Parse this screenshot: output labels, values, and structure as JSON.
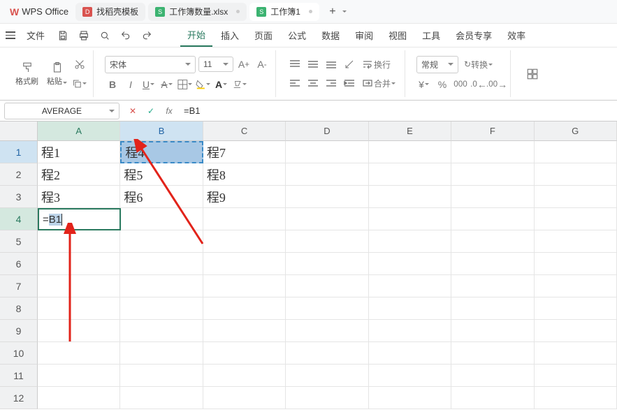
{
  "app": {
    "name": "WPS Office"
  },
  "tabs": [
    {
      "label": "找稻壳模板",
      "iconColor": "#d9534f",
      "iconText": "D"
    },
    {
      "label": "工作簿数量.xlsx",
      "iconColor": "#3cb371",
      "iconText": "S",
      "dot": true
    },
    {
      "label": "工作簿1",
      "iconColor": "#3cb371",
      "iconText": "S",
      "dot": true,
      "active": true
    }
  ],
  "menu": {
    "file": "文件",
    "items": [
      "开始",
      "插入",
      "页面",
      "公式",
      "数据",
      "审阅",
      "视图",
      "工具",
      "会员专享",
      "效率"
    ],
    "active": "开始"
  },
  "ribbon": {
    "format_painter": "格式刷",
    "paste": "粘贴",
    "font_name": "宋体",
    "font_size": "11",
    "wrap_text": "换行",
    "merge": "合并",
    "format_general": "常规",
    "convert": "转换"
  },
  "formulaBar": {
    "name": "AVERAGE",
    "fx": "fx",
    "formula": "=B1"
  },
  "sheet": {
    "columns": [
      "A",
      "B",
      "C",
      "D",
      "E",
      "F",
      "G"
    ],
    "rows": [
      "1",
      "2",
      "3",
      "4",
      "5",
      "6",
      "7",
      "8",
      "9",
      "10",
      "11",
      "12"
    ],
    "data": {
      "A1": "程1",
      "A2": "程2",
      "A3": "程3",
      "A4": "=B1",
      "B1": "程4",
      "B2": "程5",
      "B3": "程6",
      "C1": "程7",
      "C2": "程8",
      "C3": "程9"
    },
    "activeCell": "A4",
    "referencedCell": "B1"
  }
}
